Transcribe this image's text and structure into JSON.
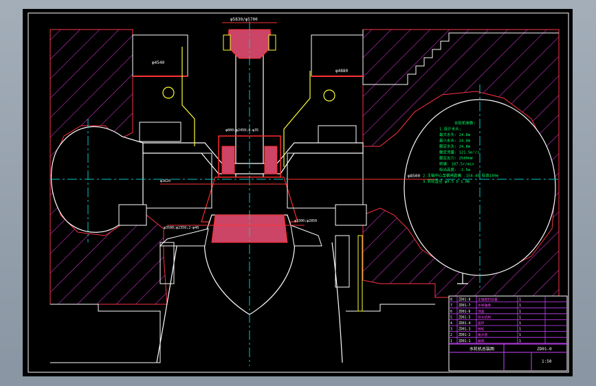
{
  "drawing": {
    "colors": {
      "background": "#000000",
      "concrete_hatch": "#cc33cc",
      "centerline": "#00cccc",
      "machinery": "#ff2a2a",
      "metal_fill": "#cc4466",
      "white_lines": "#ffffff",
      "dimension": "#ff3333",
      "notes": "#00ff66",
      "pipes": "#ffff33",
      "title_block": "#cc44ff"
    },
    "top_dim_label": "φ5830/φ5700",
    "left_label": "φ4540",
    "right_label_top": "φ4880",
    "shaft_dim": "φ800;φ2450;4-φ35",
    "mid_dim": "φ3620",
    "low_dim": "φ3500;φ2350;2-φ40",
    "runner_dim": "φ3300;φ2850",
    "right_elev": "φ8500",
    "note_lines": [
      "水轮机参数:",
      "1.设计水头:",
      "最大水头: 24.8m",
      "最小水头: 24.8m",
      "额定水头: 24.8m",
      "额定流量: 121.5m³/s",
      "额定出力: 2500kW",
      "转速: 187.5r/min",
      "吸出高度: -1.5m",
      "2.主轴中心至蜗壳距离 -154.45  标高109m",
      "3.转轮直径 φ0.5 D 1.0m"
    ],
    "title_block": {
      "rows": [
        {
          "no": "8",
          "code": "ZD01-8",
          "name": "主轴密封装置",
          "qty": "1",
          "note": ""
        },
        {
          "no": "7",
          "code": "ZD01-7",
          "name": "水导轴承",
          "qty": "1",
          "note": ""
        },
        {
          "no": "6",
          "code": "ZD01-6",
          "name": "顶盖",
          "qty": "1",
          "note": ""
        },
        {
          "no": "5",
          "code": "ZD01-5",
          "name": "导水机构",
          "qty": "1",
          "note": ""
        },
        {
          "no": "4",
          "code": "ZD01-4",
          "name": "座环",
          "qty": "1",
          "note": ""
        },
        {
          "no": "3",
          "code": "ZD01-3",
          "name": "转轮",
          "qty": "1",
          "note": ""
        },
        {
          "no": "2",
          "code": "ZD01-2",
          "name": "尾水管",
          "qty": "1",
          "note": ""
        },
        {
          "no": "1",
          "code": "ZD01-1",
          "name": "蜗壳",
          "qty": "1",
          "note": ""
        }
      ],
      "drawing_title": "水轮机总装图",
      "drawing_number": "ZD01-0",
      "scale": "1:50"
    }
  }
}
